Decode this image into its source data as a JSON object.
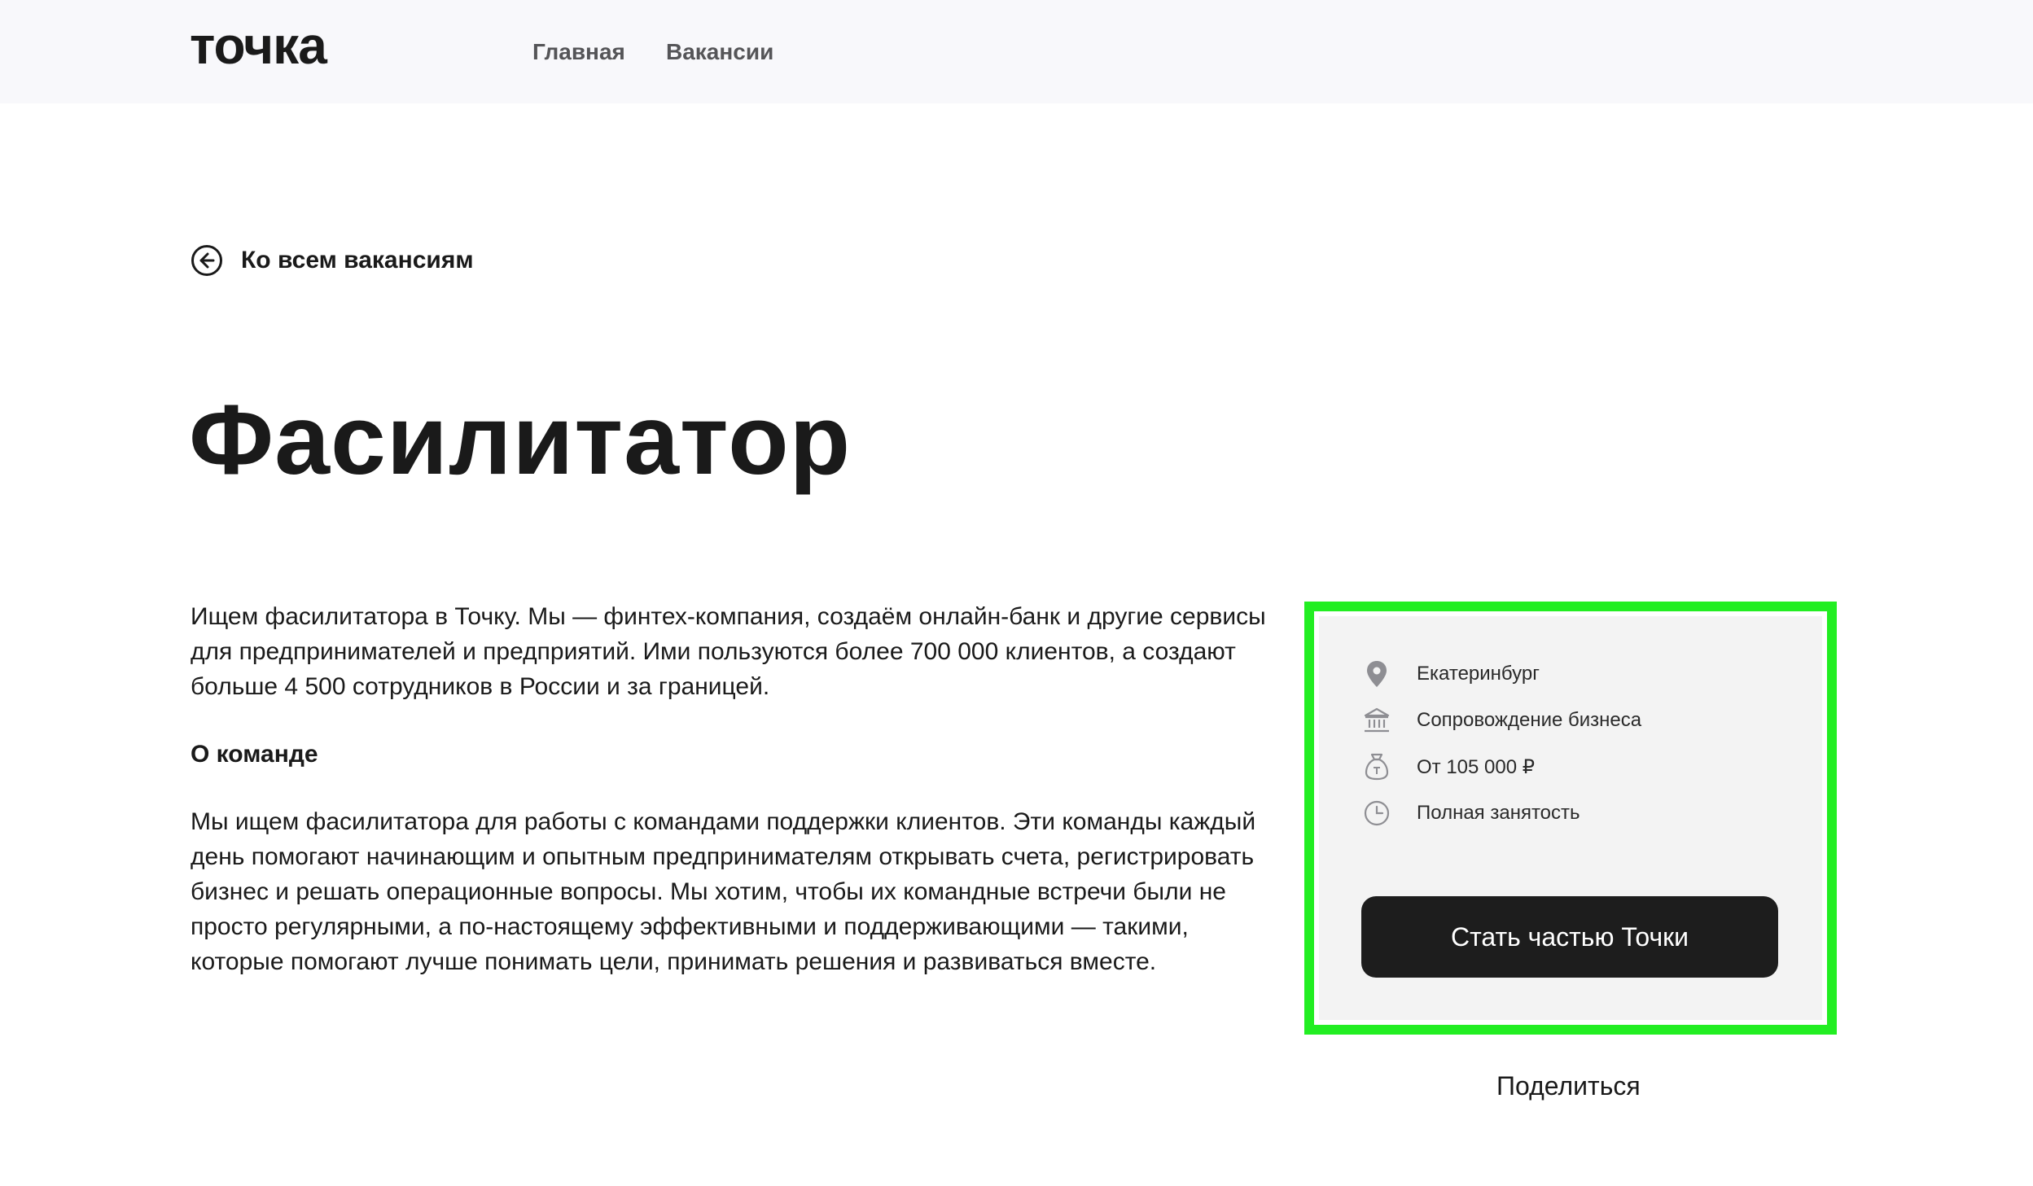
{
  "header": {
    "logo_text": "точка",
    "nav": [
      {
        "label": "Главная"
      },
      {
        "label": "Вакансии"
      }
    ]
  },
  "back_link": {
    "label": "Ко всем вакансиям",
    "icon": "arrow-left-circle-icon"
  },
  "vacancy": {
    "title": "Фасилитатор",
    "intro": "Ищем фасилитатора в Точку. Мы — финтех-компания, создаём онлайн-банк и другие сервисы для предпринимателей и предприятий. Ими пользуются более 700 000 клиентов, а создают больше 4 500 сотрудников в России и за границей.",
    "team_heading": "О команде",
    "team_text": "Мы ищем фасилитатора для работы с командами поддержки клиентов. Эти команды каждый день помогают начинающим и опытным предпринимателям открывать счета, регистрировать бизнес и решать операционные вопросы. Мы хотим, чтобы их командные встречи были не просто регулярными, а по-настоящему эффективными и поддерживающими — такими, которые помогают лучше понимать цели, принимать решения и развиваться вместе."
  },
  "card": {
    "highlight_color": "#22ee22",
    "city": {
      "text": "Екатеринбург",
      "icon": "location-pin-icon"
    },
    "department": {
      "text": "Сопровождение бизнеса",
      "icon": "bank-building-icon"
    },
    "salary": {
      "text": "От 105 000 ₽",
      "icon": "money-bag-icon"
    },
    "employment": {
      "text": "Полная занятость",
      "icon": "clock-icon"
    },
    "apply_button": "Стать частью Точки"
  },
  "share_label": "Поделиться"
}
